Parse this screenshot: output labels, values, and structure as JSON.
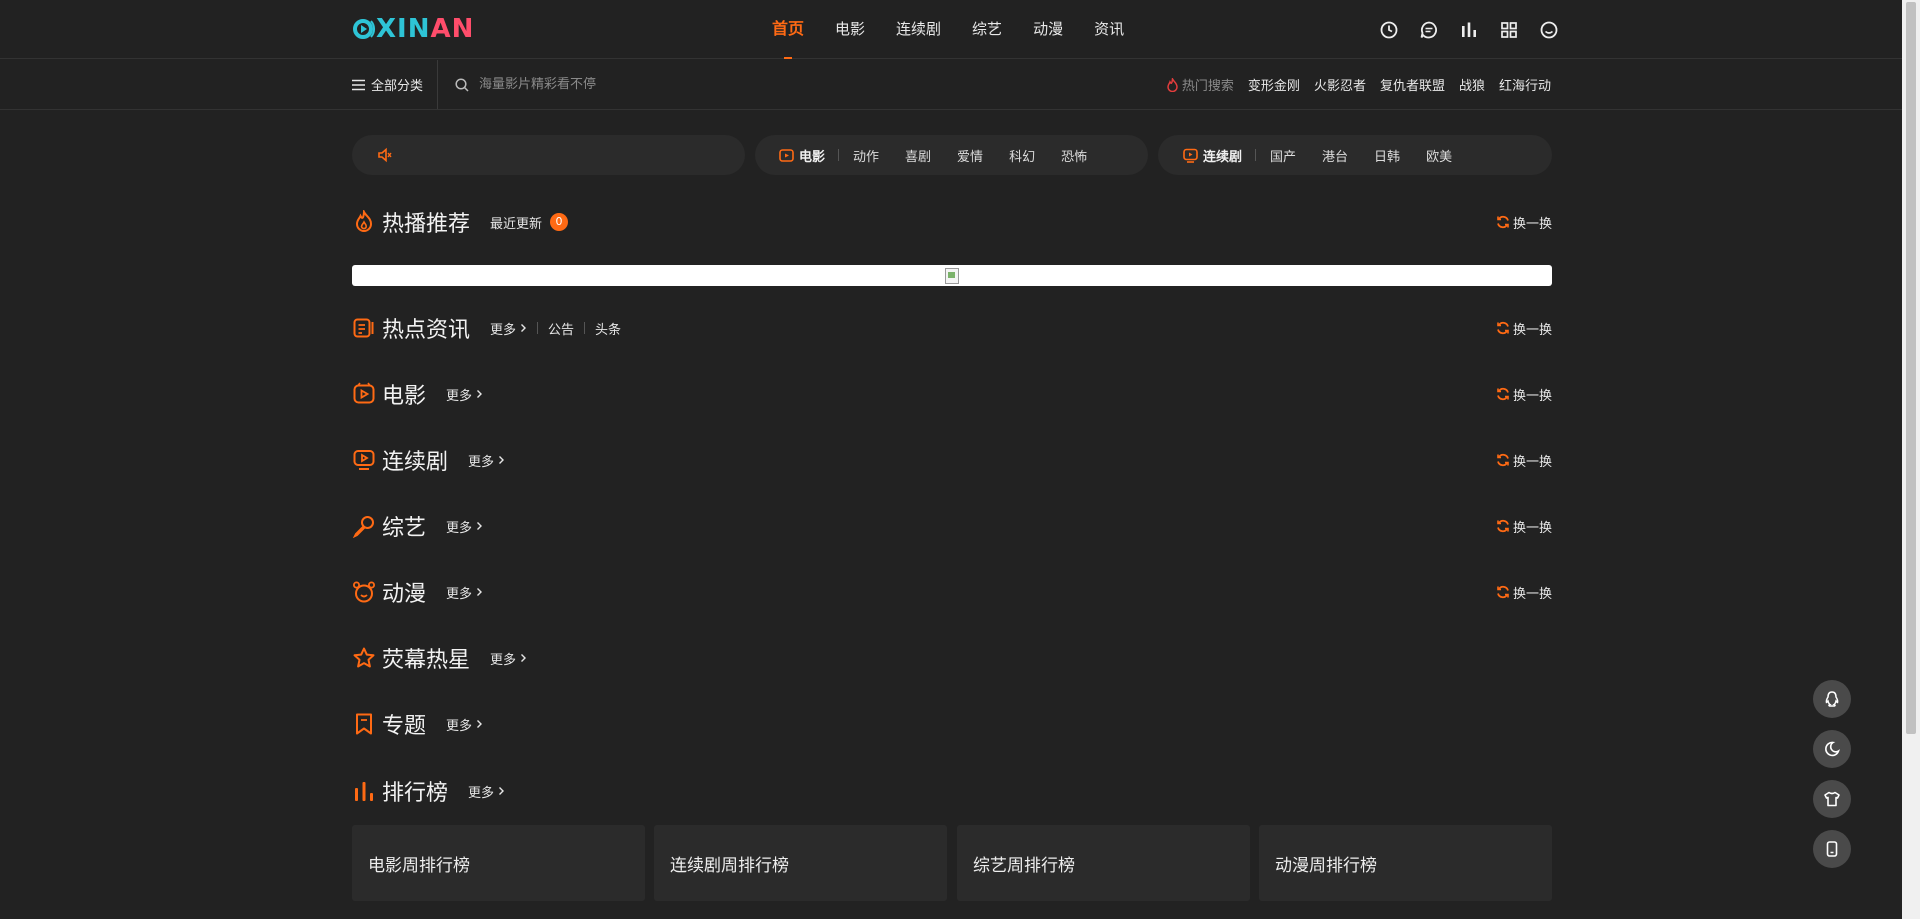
{
  "header": {
    "logo": {
      "prefix": "X",
      "mid": "IN",
      "suffix": "AN"
    },
    "nav": [
      {
        "label": "首页",
        "active": true
      },
      {
        "label": "电影",
        "active": false
      },
      {
        "label": "连续剧",
        "active": false
      },
      {
        "label": "综艺",
        "active": false
      },
      {
        "label": "动漫",
        "active": false
      },
      {
        "label": "资讯",
        "active": false
      }
    ],
    "tools": [
      "history-icon",
      "message-icon",
      "ranking-icon",
      "app-grid-icon",
      "user-icon"
    ]
  },
  "subbar": {
    "all_categories": "全部分类",
    "search_placeholder": "海量影片精彩看不停",
    "hot_label": "热门搜索",
    "hot_keywords": [
      "变形金刚",
      "火影忍者",
      "复仇者联盟",
      "战狼",
      "红海行动"
    ]
  },
  "category_bar": {
    "movie": {
      "title": "电影",
      "items": [
        "动作",
        "喜剧",
        "爱情",
        "科幻",
        "恐怖"
      ]
    },
    "series": {
      "title": "连续剧",
      "items": [
        "国产",
        "港台",
        "日韩",
        "欧美"
      ]
    }
  },
  "sections": {
    "hot_recommend": {
      "title": "热播推荐",
      "recent_label": "最近更新",
      "recent_count": "0",
      "swap": "换一换"
    },
    "news": {
      "title": "热点资讯",
      "more": "更多",
      "links": [
        "公告",
        "头条"
      ],
      "swap": "换一换"
    },
    "movie": {
      "title": "电影",
      "more": "更多",
      "swap": "换一换"
    },
    "series": {
      "title": "连续剧",
      "more": "更多",
      "swap": "换一换"
    },
    "variety": {
      "title": "综艺",
      "more": "更多",
      "swap": "换一换"
    },
    "anime": {
      "title": "动漫",
      "more": "更多",
      "swap": "换一换"
    },
    "stars": {
      "title": "荧幕热星",
      "more": "更多"
    },
    "topics": {
      "title": "专题",
      "more": "更多"
    },
    "ranking": {
      "title": "排行榜",
      "more": "更多"
    }
  },
  "rankings": [
    "电影周排行榜",
    "连续剧周排行榜",
    "综艺周排行榜",
    "动漫周排行榜"
  ],
  "colors": {
    "accent": "#ff6a14",
    "background": "#222222",
    "card": "#2b2b2b"
  }
}
